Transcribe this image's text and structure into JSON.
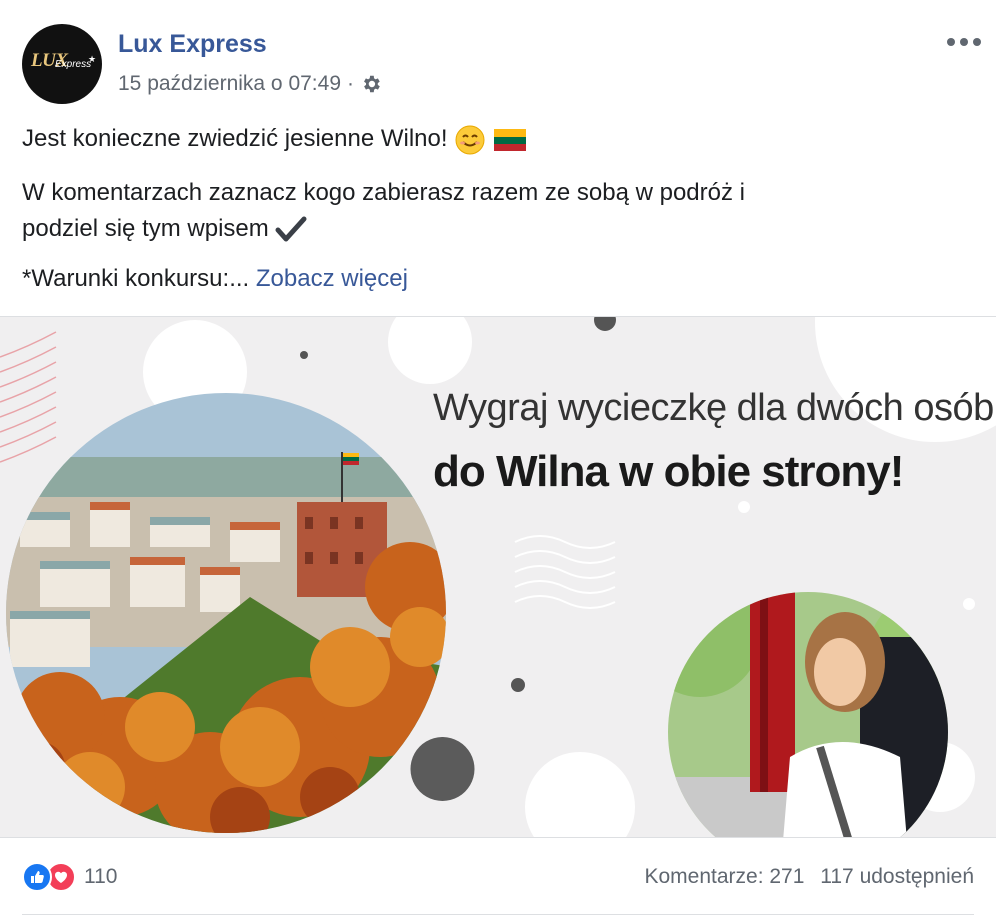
{
  "post": {
    "page_name": "Lux Express",
    "avatar": {
      "logo_text": "LUX",
      "logo_subtext": "Express"
    },
    "timestamp": "15 października o 07:49",
    "separator": "·",
    "audience_icon": "gear-icon",
    "more_icon": "more-dots-icon",
    "text_line1": "Jest konieczne zwiedzić jesienne Wilno!",
    "text_line2": "W komentarzach zaznacz kogo zabierasz razem ze sobą w podróż i",
    "text_line3": "podziel się tym wpisem",
    "text_line4": "*Warunki konkursu:...",
    "see_more": "Zobacz więcej",
    "emojis": [
      "smiling-face-emoji",
      "lithuania-flag-emoji",
      "check-mark-emoji"
    ]
  },
  "banner": {
    "headline_1": "Wygraj wycieczkę dla dwóch osób",
    "headline_2": "do Wilna w obie strony!"
  },
  "stats": {
    "reaction_icons": [
      "like-icon",
      "love-icon"
    ],
    "reaction_count": "110",
    "comments": "Komentarze: 271",
    "shares": "117 udostępnień"
  },
  "colors": {
    "link": "#385898",
    "secondary_text": "#606770",
    "like": "#1877f2",
    "love": "#f33e58",
    "banner_bg": "#f0eff0"
  }
}
